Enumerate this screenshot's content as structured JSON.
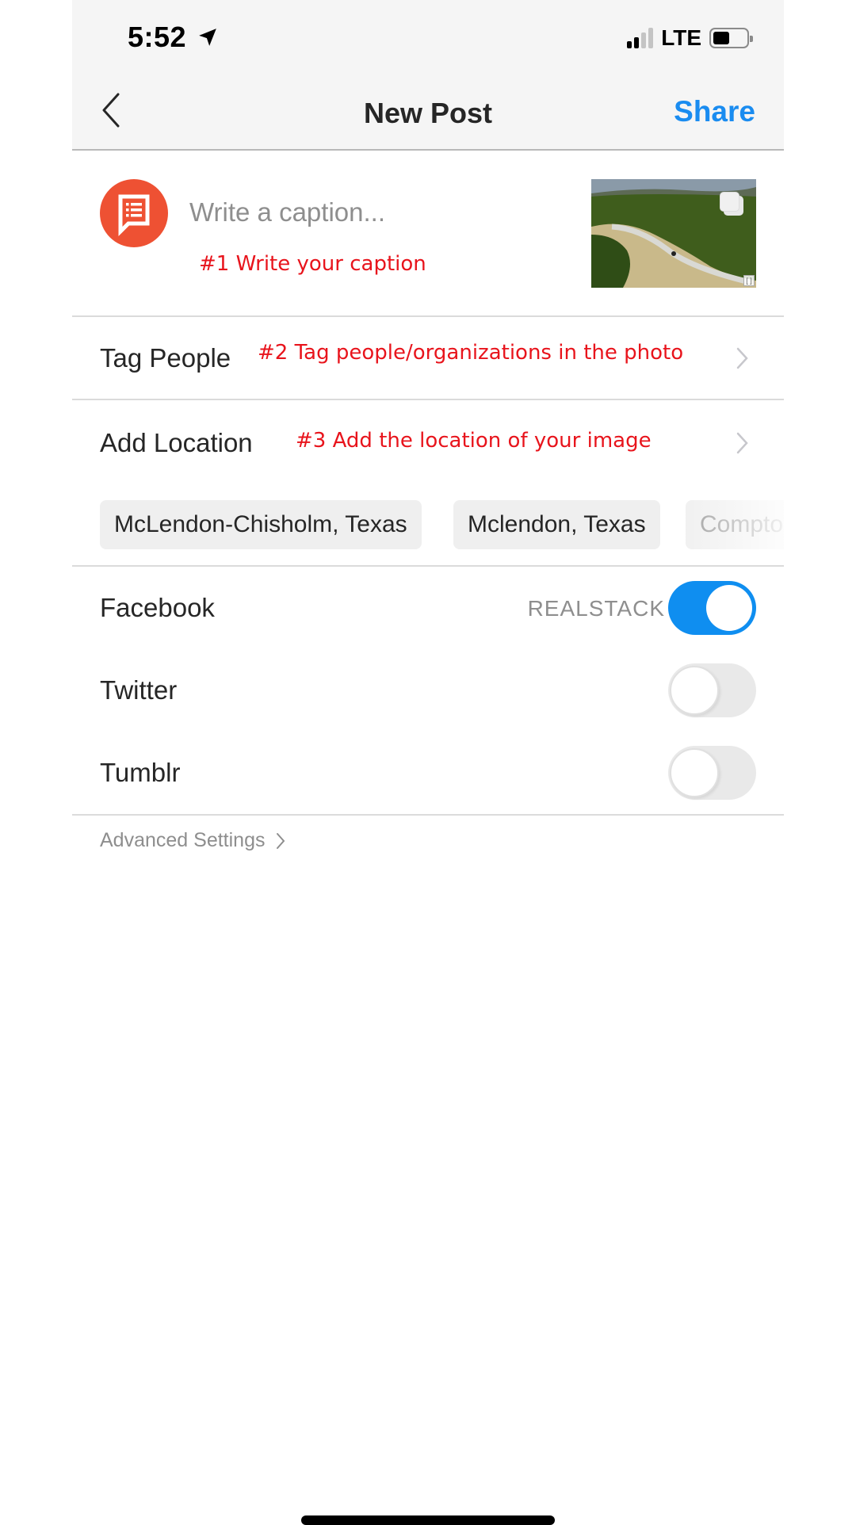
{
  "status_bar": {
    "time": "5:52",
    "location_icon": "location-arrow-icon",
    "signal_bars_active": 2,
    "signal_bars_total": 4,
    "network": "LTE",
    "battery_level": 0.45
  },
  "nav": {
    "back_icon": "chevron-left-icon",
    "title": "New Post",
    "share_label": "Share",
    "share_color": "#1a8cf0"
  },
  "caption": {
    "avatar_icon": "speech-bubble-list-icon",
    "avatar_color": "#ee5133",
    "placeholder": "Write a caption...",
    "value": "",
    "annotation": "#1 Write your caption",
    "thumbnail_alt": "Aerial photo of a dirt road through green wooded hills",
    "multi_photo_icon": "stacked-squares-icon"
  },
  "rows": {
    "tag_people": {
      "label": "Tag People",
      "annotation": "#2 Tag people/organizations in the photo"
    },
    "add_location": {
      "label": "Add Location",
      "annotation": "#3 Add the location of your image"
    }
  },
  "location_suggestions": [
    "McLendon-Chisholm, Texas",
    "Mclendon, Texas",
    "Compton"
  ],
  "share_to": [
    {
      "label": "Facebook",
      "account": "REALSTACK",
      "enabled": true
    },
    {
      "label": "Twitter",
      "account": "",
      "enabled": false
    },
    {
      "label": "Tumblr",
      "account": "",
      "enabled": false
    }
  ],
  "advanced_settings_label": "Advanced Settings",
  "colors": {
    "accent_blue": "#1a8cf0",
    "toggle_on": "#0f8ef0",
    "annotation_red": "#e8141c"
  }
}
